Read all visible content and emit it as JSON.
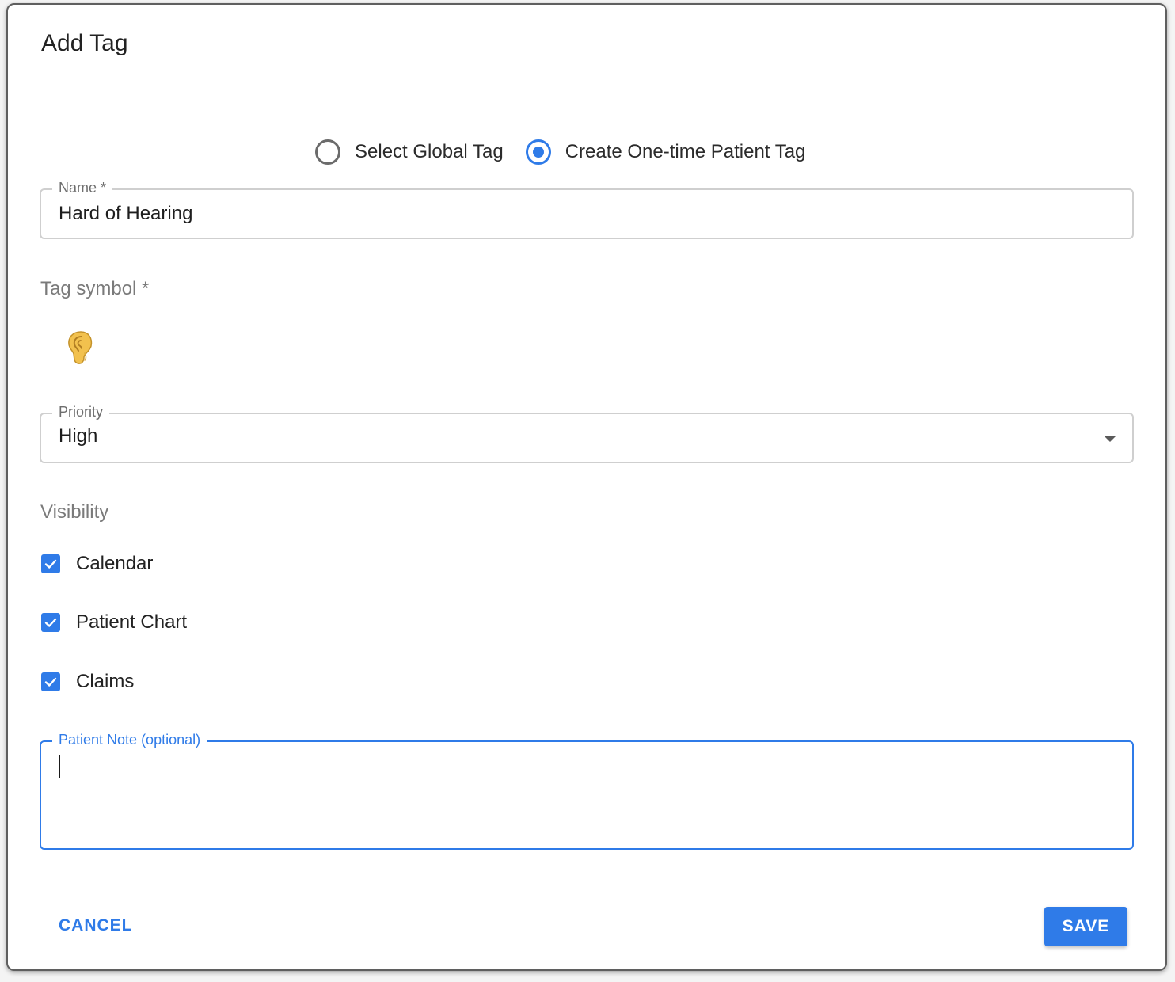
{
  "dialog": {
    "title": "Add Tag"
  },
  "tag_type": {
    "options": [
      {
        "label": "Select Global Tag",
        "selected": false
      },
      {
        "label": "Create One-time Patient Tag",
        "selected": true
      }
    ]
  },
  "name_field": {
    "label": "Name *",
    "value": "Hard of Hearing"
  },
  "tag_symbol": {
    "label": "Tag symbol *",
    "icon": "ear-icon"
  },
  "priority_field": {
    "label": "Priority",
    "value": "High"
  },
  "visibility": {
    "label": "Visibility",
    "items": [
      {
        "label": "Calendar",
        "checked": true
      },
      {
        "label": "Patient Chart",
        "checked": true
      },
      {
        "label": "Claims",
        "checked": true
      }
    ]
  },
  "note_field": {
    "label": "Patient Note (optional)",
    "value": ""
  },
  "actions": {
    "cancel_label": "CANCEL",
    "save_label": "SAVE"
  },
  "colors": {
    "accent": "#2f7be8",
    "border": "#cfcfcf",
    "muted_text": "#7a7a7a"
  }
}
